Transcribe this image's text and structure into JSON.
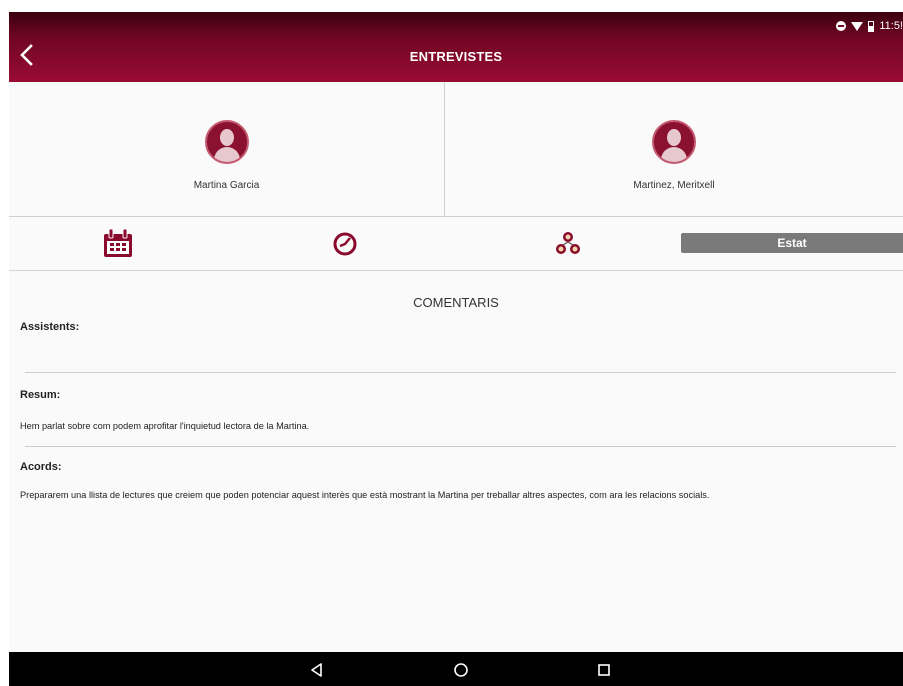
{
  "status_bar": {
    "time": "11:5!"
  },
  "header": {
    "title": "ENTREVISTES"
  },
  "participants": [
    {
      "name": "Martina Garcia"
    },
    {
      "name": "Martinez, Meritxell"
    }
  ],
  "tabs": {
    "estat_label": "Estat"
  },
  "comments": {
    "section_title": "COMENTARIS",
    "assistents_label": "Assistents:",
    "assistents_value": "",
    "resum_label": "Resum:",
    "resum_value": "Hem parlat sobre com podem aprofitar l'inquietud lectora de la Martina.",
    "acords_label": "Acords:",
    "acords_value": "Prepararem una llista de lectures que creiem que poden potenciar aquest interès  que està mostrant la Martina per treballar altres aspectes, com ara les relacions socials."
  },
  "colors": {
    "brand": "#8a0a2e",
    "brand_dark": "#3a0010",
    "estat_bg": "#7a7a7a"
  },
  "icons": [
    "back-arrow-icon",
    "calendar-icon",
    "clock-icon",
    "group-icon",
    "nav-back-icon",
    "nav-home-icon",
    "nav-recent-icon"
  ]
}
